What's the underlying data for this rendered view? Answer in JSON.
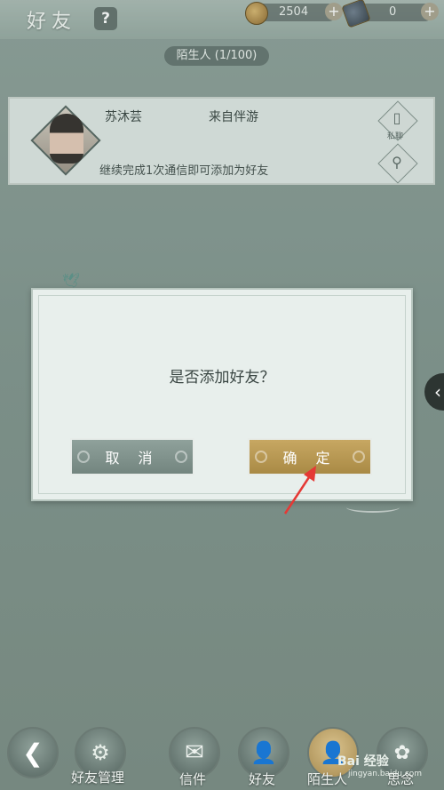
{
  "header": {
    "title": "好友",
    "help_label": "?",
    "coins": "2504",
    "secondary_currency": "0"
  },
  "tab": {
    "label": "陌生人 (1/100)"
  },
  "stranger": {
    "name": "苏沐芸",
    "source": "来自伴游",
    "hint": "继续完成1次通信即可添加为好友",
    "chat_badge": "私聊"
  },
  "dialog": {
    "question": "是否添加好友？",
    "cancel_label": "取 消",
    "confirm_label": "确 定"
  },
  "bottom_nav": {
    "manage_label": "好友管理",
    "items": [
      {
        "label": "信件"
      },
      {
        "label": "好友"
      },
      {
        "label": "陌生人"
      },
      {
        "label": "思念"
      }
    ]
  },
  "watermark": {
    "brand": "Bai 经验",
    "url": "jingyan.baidu.com"
  },
  "colors": {
    "confirm": "#b8984f",
    "cancel": "#7f918b",
    "annotation_arrow": "#e53935"
  }
}
